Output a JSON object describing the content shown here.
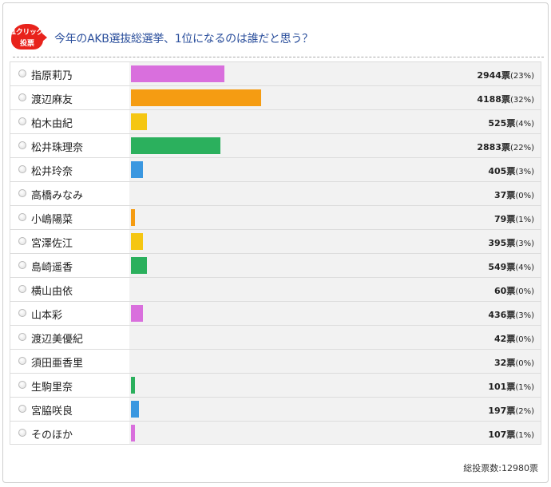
{
  "header": {
    "badge_line1": "1クリック",
    "badge_line2": "投票",
    "title": "今年のAKB選抜総選挙、1位になるのは誰だと思う？"
  },
  "options": [
    {
      "name": "指原莉乃",
      "votes": "2944票",
      "pct": "(23%)",
      "share": 23,
      "color": "#d96fdd"
    },
    {
      "name": "渡辺麻友",
      "votes": "4188票",
      "pct": "(32%)",
      "share": 32,
      "color": "#f59c12"
    },
    {
      "name": "柏木由紀",
      "votes": "525票",
      "pct": "(4%)",
      "share": 4,
      "color": "#f5c612"
    },
    {
      "name": "松井珠理奈",
      "votes": "2883票",
      "pct": "(22%)",
      "share": 22,
      "color": "#2bb05d"
    },
    {
      "name": "松井玲奈",
      "votes": "405票",
      "pct": "(3%)",
      "share": 3,
      "color": "#3a97e0"
    },
    {
      "name": "高橋みなみ",
      "votes": "37票",
      "pct": "(0%)",
      "share": 0,
      "color": "#d96fdd"
    },
    {
      "name": "小嶋陽菜",
      "votes": "79票",
      "pct": "(1%)",
      "share": 1,
      "color": "#f59c12"
    },
    {
      "name": "宮澤佐江",
      "votes": "395票",
      "pct": "(3%)",
      "share": 3,
      "color": "#f5c612"
    },
    {
      "name": "島崎遥香",
      "votes": "549票",
      "pct": "(4%)",
      "share": 4,
      "color": "#2bb05d"
    },
    {
      "name": "横山由依",
      "votes": "60票",
      "pct": "(0%)",
      "share": 0,
      "color": "#3a97e0"
    },
    {
      "name": "山本彩",
      "votes": "436票",
      "pct": "(3%)",
      "share": 3,
      "color": "#d96fdd"
    },
    {
      "name": "渡辺美優紀",
      "votes": "42票",
      "pct": "(0%)",
      "share": 0,
      "color": "#f59c12"
    },
    {
      "name": "須田亜香里",
      "votes": "32票",
      "pct": "(0%)",
      "share": 0,
      "color": "#f5c612"
    },
    {
      "name": "生駒里奈",
      "votes": "101票",
      "pct": "(1%)",
      "share": 1,
      "color": "#2bb05d"
    },
    {
      "name": "宮脇咲良",
      "votes": "197票",
      "pct": "(2%)",
      "share": 2,
      "color": "#3a97e0"
    },
    {
      "name": "そのほか",
      "votes": "107票",
      "pct": "(1%)",
      "share": 1,
      "color": "#d96fdd"
    }
  ],
  "footer": {
    "total": "総投票数:12980票"
  }
}
